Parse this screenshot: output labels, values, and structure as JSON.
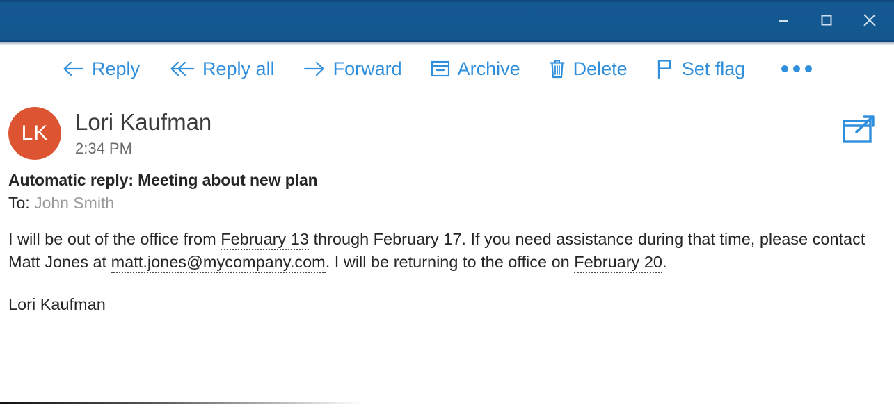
{
  "window": {
    "accent_color": "#14578F",
    "buttons": [
      {
        "name": "minimize",
        "icon": "minimize-icon",
        "label": "Minimize"
      },
      {
        "name": "maximize",
        "icon": "maximize-icon",
        "label": "Maximize"
      },
      {
        "name": "close",
        "icon": "close-icon",
        "label": "Close"
      }
    ]
  },
  "toolbar": {
    "link_color": "#2F8FDC",
    "items": [
      {
        "label": "Reply",
        "icon": "arrow-left-icon"
      },
      {
        "label": "Reply all",
        "icon": "double-arrow-left-icon"
      },
      {
        "label": "Forward",
        "icon": "arrow-right-icon"
      },
      {
        "label": "Archive",
        "icon": "archive-box-icon"
      },
      {
        "label": "Delete",
        "icon": "trash-icon"
      },
      {
        "label": "Set flag",
        "icon": "flag-icon"
      }
    ],
    "more_label": "More actions",
    "more_icon": "ellipsis-icon"
  },
  "message": {
    "sender_name": "Lori Kaufman",
    "sender_initials": "LK",
    "avatar_color": "#DC5431",
    "time": "2:34 PM",
    "popout_icon": "open-in-new-window-icon",
    "subject": "Automatic reply: Meeting about new plan",
    "to_label": "To:",
    "recipient": "John Smith",
    "body": {
      "line1_pre": "I will be out of the office from ",
      "date_start": "February 13",
      "line1_mid": " through February 17. If you need assistance during that time, please contact Matt Jones at ",
      "email": "matt.jones@mycompany.com",
      "line1_post": ". I will be returning to the office on ",
      "date_return": "February 20",
      "line1_end": ".",
      "signature": "Lori Kaufman"
    }
  }
}
